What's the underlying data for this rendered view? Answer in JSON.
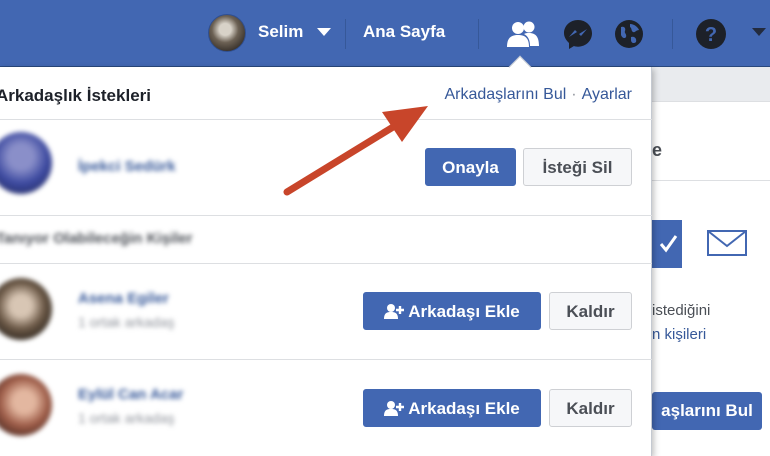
{
  "topbar": {
    "user_name": "Selim",
    "home_label": "Ana Sayfa",
    "icons": [
      "avatar",
      "dropdown-caret-icon",
      "friends-icon",
      "messenger-icon",
      "globe-icon",
      "help-icon",
      "settings-caret-icon"
    ],
    "background": "#4267b2"
  },
  "panel": {
    "title": "Arkadaşlık İstekleri",
    "find_friends_link": "Arkadaşlarını Bul",
    "link_separator": "·",
    "settings_link": "Ayarlar",
    "requests": [
      {
        "name": "İpekci Sedürk",
        "confirm_label": "Onayla",
        "delete_label": "İsteği Sil"
      }
    ],
    "suggestions_label": "Tanıyor Olabileceğin Kişiler",
    "suggestions": [
      {
        "name": "Asena Egiler",
        "sub": "1 ortak arkadaş",
        "add_label": "Arkadaşı Ekle",
        "remove_label": "Kaldır"
      },
      {
        "name": "Eylül Can Acar",
        "sub": "1 ortak arkadaş",
        "add_label": "Arkadaşı Ekle",
        "remove_label": "Kaldır"
      }
    ]
  },
  "background_page": {
    "title_fragment": "e",
    "text_line1": "istediğini",
    "text_line2": "n kişileri",
    "button_label": "aşlarını Bul"
  },
  "annotation": {
    "arrow_color": "#c8452a"
  }
}
